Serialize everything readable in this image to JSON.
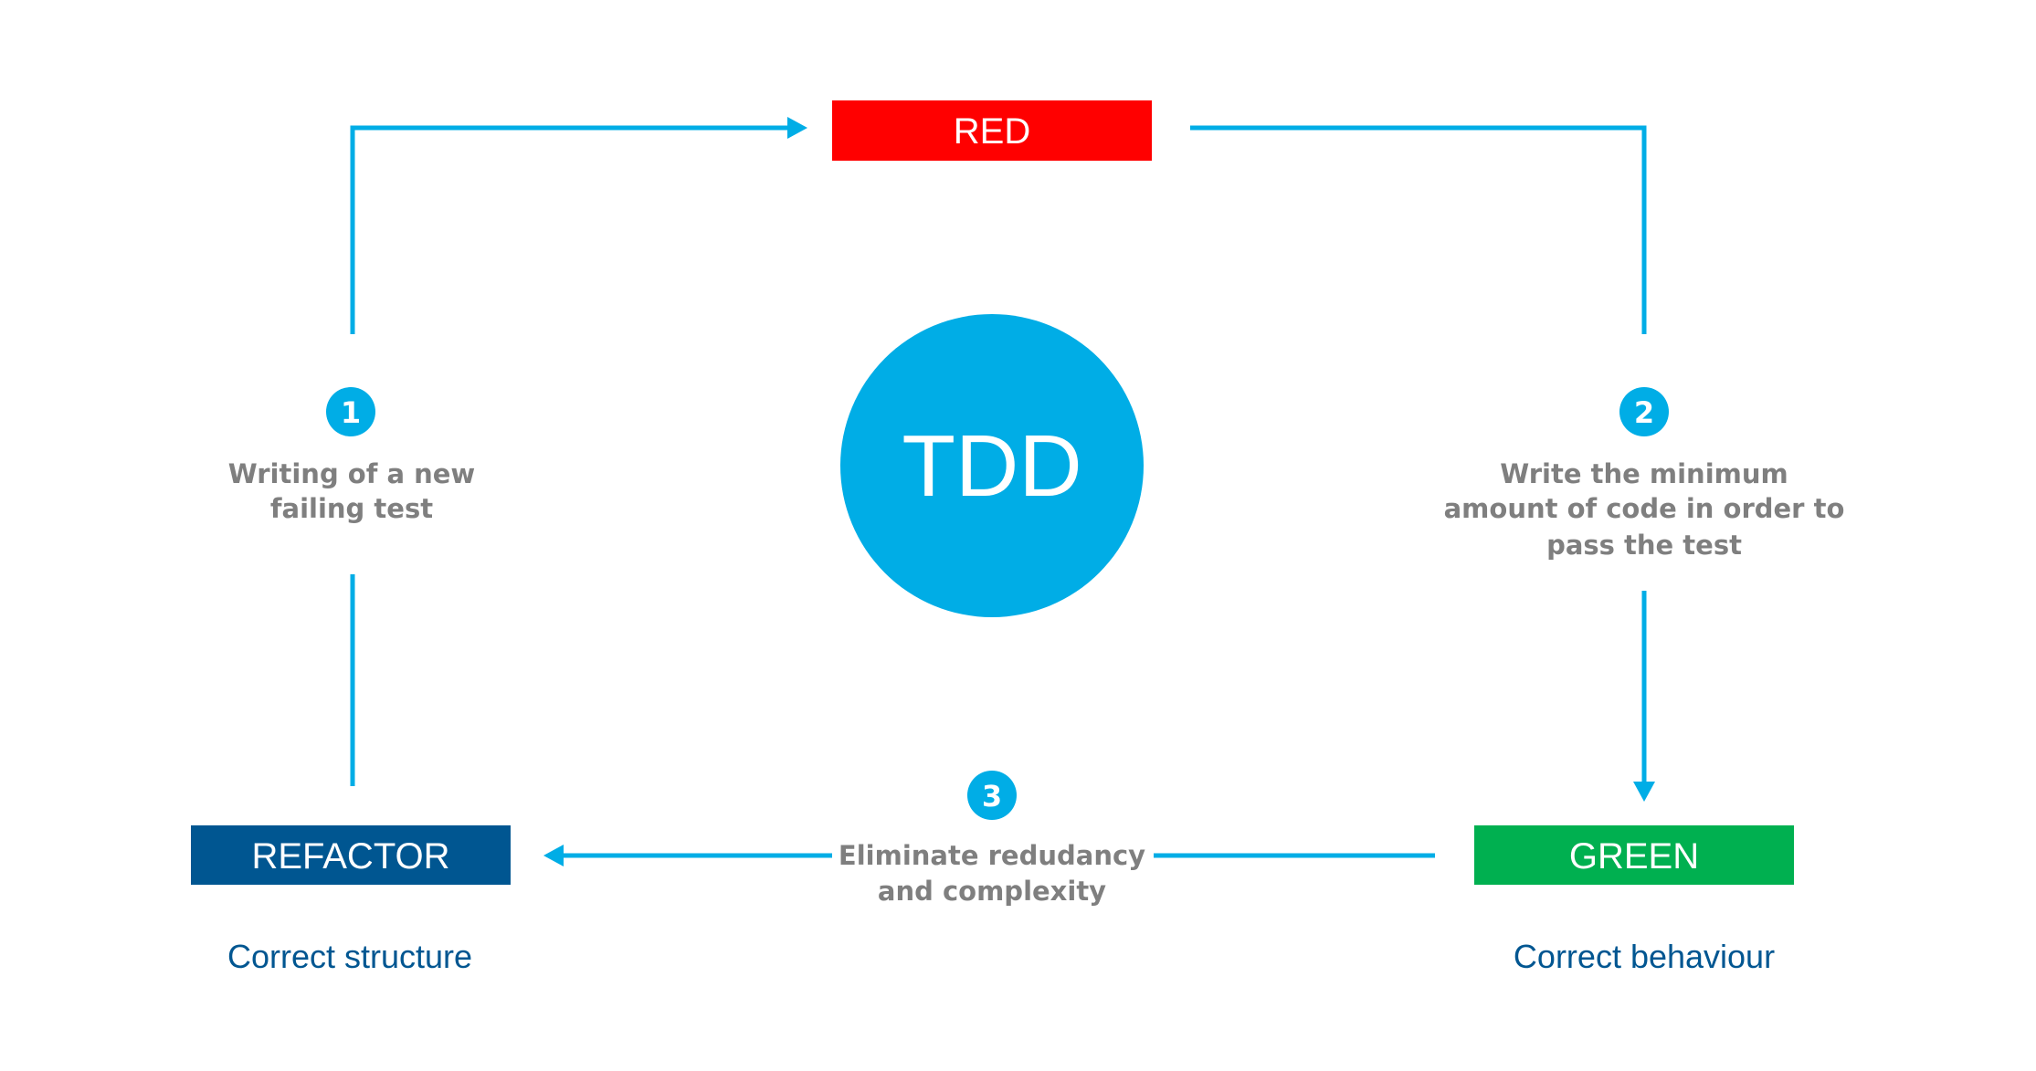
{
  "center": {
    "label": "TDD"
  },
  "phases": {
    "red": {
      "label": "RED",
      "color": "#ff0000"
    },
    "green": {
      "label": "GREEN",
      "color": "#00b050",
      "caption": "Correct behaviour"
    },
    "refactor": {
      "label": "REFACTOR",
      "color": "#005691",
      "caption": "Correct structure"
    }
  },
  "steps": [
    {
      "number": "1",
      "lines": [
        "Writing of a new",
        "failing test"
      ]
    },
    {
      "number": "2",
      "lines": [
        "Write the minimum",
        "amount of code in order to",
        "pass the test"
      ]
    },
    {
      "number": "3",
      "lines": [
        "Eliminate redudancy",
        "and complexity"
      ]
    }
  ],
  "colors": {
    "accent": "#00ade6",
    "step_text": "#7f7f7f",
    "caption_text": "#005691"
  }
}
